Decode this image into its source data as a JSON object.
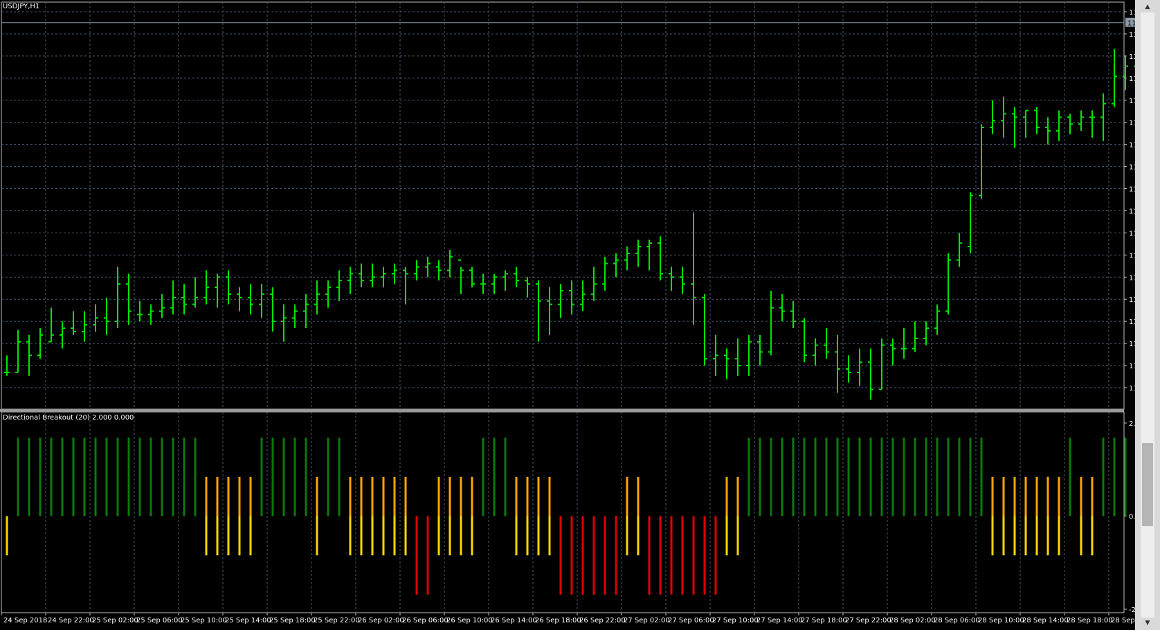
{
  "chart": {
    "symbol_label": "USDJPY,H1",
    "current_price": "113.678",
    "price_ticks": [
      "113.710",
      "113.645",
      "113.580",
      "113.515",
      "113.450",
      "113.385",
      "113.320",
      "113.255",
      "113.190",
      "113.125",
      "113.060",
      "112.995",
      "112.930",
      "112.865",
      "112.800",
      "112.735",
      "112.670",
      "112.605"
    ],
    "time_labels": [
      "24 Sep 2018",
      "24 Sep 22:00",
      "25 Sep 02:00",
      "25 Sep 06:00",
      "25 Sep 10:00",
      "25 Sep 14:00",
      "25 Sep 18:00",
      "25 Sep 22:00",
      "26 Sep 02:00",
      "26 Sep 06:00",
      "26 Sep 10:00",
      "26 Sep 14:00",
      "26 Sep 18:00",
      "26 Sep 22:00",
      "27 Sep 02:00",
      "27 Sep 06:00",
      "27 Sep 10:00",
      "27 Sep 14:00",
      "27 Sep 18:00",
      "27 Sep 22:00",
      "28 Sep 02:00",
      "28 Sep 06:00",
      "28 Sep 10:00",
      "28 Sep 14:00",
      "28 Sep 18:00",
      "28 Sep 22:00"
    ]
  },
  "indicator": {
    "label": "Directional Breakout (20) 2.000 0.000",
    "ticks": [
      "2.420",
      "0.000",
      "-2.420"
    ]
  },
  "colors": {
    "bar_up": "#00e600",
    "grid": "#4a5a6a",
    "strong_up": "#0a7a0a",
    "weak_up": "#ffa500",
    "weak_down": "#ffd700",
    "strong_down": "#e00000"
  },
  "chart_data": {
    "type": "ohlc",
    "timeframe": "H1",
    "price_bars": [
      [
        112.65,
        112.7,
        112.64,
        112.65
      ],
      [
        112.65,
        112.775,
        112.65,
        112.74
      ],
      [
        112.74,
        112.76,
        112.64,
        112.7
      ],
      [
        112.7,
        112.78,
        112.69,
        112.76
      ],
      [
        112.74,
        112.84,
        112.74,
        112.76
      ],
      [
        112.76,
        112.8,
        112.72,
        112.78
      ],
      [
        112.78,
        112.83,
        112.76,
        112.77
      ],
      [
        112.77,
        112.83,
        112.74,
        112.79
      ],
      [
        112.79,
        112.85,
        112.77,
        112.81
      ],
      [
        112.81,
        112.87,
        112.76,
        112.8
      ],
      [
        112.8,
        112.96,
        112.78,
        112.91
      ],
      [
        112.91,
        112.94,
        112.79,
        112.83
      ],
      [
        112.82,
        112.86,
        112.8,
        112.82
      ],
      [
        112.82,
        112.85,
        112.79,
        112.83
      ],
      [
        112.83,
        112.88,
        112.81,
        112.84
      ],
      [
        112.84,
        112.92,
        112.82,
        112.87
      ],
      [
        112.87,
        112.91,
        112.82,
        112.85
      ],
      [
        112.85,
        112.93,
        112.84,
        112.87
      ],
      [
        112.87,
        112.95,
        112.85,
        112.9
      ],
      [
        112.9,
        112.94,
        112.84,
        112.93
      ],
      [
        112.93,
        112.95,
        112.85,
        112.88
      ],
      [
        112.88,
        112.9,
        112.83,
        112.87
      ],
      [
        112.87,
        112.91,
        112.82,
        112.85
      ],
      [
        112.85,
        112.91,
        112.81,
        112.88
      ],
      [
        112.88,
        112.9,
        112.77,
        112.8
      ],
      [
        112.8,
        112.85,
        112.74,
        112.81
      ],
      [
        112.81,
        112.85,
        112.78,
        112.83
      ],
      [
        112.83,
        112.88,
        112.78,
        112.85
      ],
      [
        112.85,
        112.92,
        112.82,
        112.88
      ],
      [
        112.88,
        112.92,
        112.84,
        112.9
      ],
      [
        112.9,
        112.95,
        112.86,
        112.92
      ],
      [
        112.92,
        112.96,
        112.88,
        112.94
      ],
      [
        112.94,
        112.97,
        112.9,
        112.92
      ],
      [
        112.92,
        112.97,
        112.9,
        112.93
      ],
      [
        112.93,
        112.96,
        112.9,
        112.94
      ],
      [
        112.94,
        112.97,
        112.91,
        112.95
      ],
      [
        112.95,
        112.96,
        112.85,
        112.94
      ],
      [
        112.94,
        112.98,
        112.92,
        112.96
      ],
      [
        112.96,
        112.99,
        112.93,
        112.97
      ],
      [
        112.96,
        112.98,
        112.92,
        112.95
      ],
      [
        112.95,
        113.01,
        112.93,
        112.99
      ],
      [
        112.98,
        112.96,
        112.88,
        112.95
      ],
      [
        112.95,
        112.96,
        112.9,
        112.91
      ],
      [
        112.91,
        112.94,
        112.88,
        112.91
      ],
      [
        112.91,
        112.94,
        112.88,
        112.93
      ],
      [
        112.93,
        112.95,
        112.89,
        112.94
      ],
      [
        112.94,
        112.96,
        112.9,
        112.92
      ],
      [
        112.92,
        112.93,
        112.87,
        112.91
      ],
      [
        112.91,
        112.92,
        112.74,
        112.86
      ],
      [
        112.86,
        112.9,
        112.76,
        112.85
      ],
      [
        112.85,
        112.91,
        112.81,
        112.89
      ],
      [
        112.89,
        112.92,
        112.82,
        112.85
      ],
      [
        112.85,
        112.92,
        112.83,
        112.88
      ],
      [
        112.88,
        112.96,
        112.86,
        112.91
      ],
      [
        112.91,
        112.99,
        112.89,
        112.97
      ],
      [
        112.97,
        113.0,
        112.93,
        112.98
      ],
      [
        112.98,
        113.02,
        112.95,
        113.0
      ],
      [
        113.0,
        113.04,
        112.96,
        113.02
      ],
      [
        113.02,
        113.04,
        112.95,
        113.03
      ],
      [
        113.03,
        113.05,
        112.92,
        112.94
      ],
      [
        112.94,
        112.96,
        112.89,
        112.93
      ],
      [
        112.93,
        112.96,
        112.88,
        112.91
      ],
      [
        112.91,
        113.12,
        112.79,
        112.87
      ],
      [
        112.87,
        112.88,
        112.67,
        112.69
      ],
      [
        112.69,
        112.76,
        112.64,
        112.7
      ],
      [
        112.7,
        112.72,
        112.63,
        112.69
      ],
      [
        112.69,
        112.75,
        112.64,
        112.67
      ],
      [
        112.67,
        112.76,
        112.64,
        112.74
      ],
      [
        112.74,
        112.76,
        112.67,
        112.71
      ],
      [
        112.71,
        112.89,
        112.7,
        112.84
      ],
      [
        112.84,
        112.88,
        112.8,
        112.83
      ],
      [
        112.83,
        112.86,
        112.78,
        112.8
      ],
      [
        112.8,
        112.81,
        112.68,
        112.7
      ],
      [
        112.7,
        112.75,
        112.67,
        112.73
      ],
      [
        112.73,
        112.78,
        112.69,
        112.71
      ],
      [
        112.71,
        112.76,
        112.59,
        112.66
      ],
      [
        112.66,
        112.7,
        112.62,
        112.65
      ],
      [
        112.65,
        112.72,
        112.61,
        112.68
      ],
      [
        112.68,
        112.72,
        112.57,
        112.6
      ],
      [
        112.6,
        112.75,
        112.6,
        112.73
      ],
      [
        112.73,
        112.75,
        112.67,
        112.72
      ],
      [
        112.72,
        112.78,
        112.69,
        112.72
      ],
      [
        112.72,
        112.8,
        112.71,
        112.75
      ],
      [
        112.75,
        112.8,
        112.73,
        112.78
      ],
      [
        112.78,
        112.85,
        112.76,
        112.83
      ],
      [
        112.83,
        113.0,
        112.82,
        112.98
      ],
      [
        112.98,
        113.06,
        112.96,
        113.03
      ],
      [
        113.02,
        113.18,
        113.0,
        113.17
      ],
      [
        113.17,
        113.38,
        113.16,
        113.37
      ],
      [
        113.37,
        113.45,
        113.35,
        113.39
      ],
      [
        113.39,
        113.46,
        113.34,
        113.41
      ],
      [
        113.41,
        113.43,
        113.31,
        113.4
      ],
      [
        113.4,
        113.42,
        113.34,
        113.42
      ],
      [
        113.42,
        113.43,
        113.35,
        113.37
      ],
      [
        113.37,
        113.4,
        113.32,
        113.36
      ],
      [
        113.36,
        113.42,
        113.33,
        113.4
      ],
      [
        113.4,
        113.41,
        113.35,
        113.38
      ],
      [
        113.38,
        113.42,
        113.36,
        113.4
      ],
      [
        113.4,
        113.42,
        113.34,
        113.4
      ],
      [
        113.4,
        113.47,
        113.33,
        113.44
      ],
      [
        113.44,
        113.6,
        113.43,
        113.52
      ],
      [
        113.52,
        113.58,
        113.48,
        113.55
      ],
      [
        113.55,
        113.56,
        113.45,
        113.53
      ],
      [
        113.53,
        113.56,
        113.47,
        113.52
      ],
      [
        113.52,
        113.61,
        113.48,
        113.56
      ],
      [
        113.56,
        113.62,
        113.42,
        113.47
      ],
      [
        113.47,
        113.55,
        113.37,
        113.41
      ],
      [
        113.41,
        113.47,
        113.36,
        113.43
      ],
      [
        113.43,
        113.49,
        113.37,
        113.41
      ],
      [
        113.41,
        113.5,
        113.33,
        113.48
      ],
      [
        113.48,
        113.49,
        113.39,
        113.43
      ],
      [
        113.43,
        113.44,
        113.36,
        113.43
      ],
      [
        113.43,
        113.44,
        113.32,
        113.4
      ],
      [
        113.4,
        113.41,
        113.34,
        113.36
      ],
      [
        113.36,
        113.44,
        113.31,
        113.37
      ],
      [
        113.37,
        113.44,
        113.36,
        113.41
      ],
      [
        113.41,
        113.52,
        113.39,
        113.5
      ],
      [
        113.5,
        113.64,
        113.44,
        113.6
      ],
      [
        113.6,
        113.63,
        113.43,
        113.47
      ],
      [
        113.47,
        113.51,
        113.46,
        113.48
      ],
      [
        113.48,
        113.6,
        113.47,
        113.57
      ],
      [
        113.57,
        113.6,
        113.53,
        113.58
      ],
      [
        113.58,
        113.61,
        113.54,
        113.6
      ],
      [
        113.6,
        113.72,
        113.6,
        113.68
      ]
    ],
    "indicator_values": [
      "y",
      "g",
      "g",
      "g",
      "g",
      "g",
      "g",
      "g",
      "g",
      "g",
      "g",
      "g",
      "g",
      "g",
      "g",
      "g",
      "g",
      "g",
      "o",
      "o",
      "o",
      "o",
      "o",
      "g",
      "g",
      "g",
      "g",
      "g",
      "o",
      "g",
      "g",
      "o",
      "o",
      "o",
      "o",
      "o",
      "o",
      "r",
      "r",
      "o",
      "o",
      "o",
      "o",
      "g",
      "g",
      "g",
      "o",
      "o",
      "o",
      "o",
      "r",
      "r",
      "r",
      "r",
      "r",
      "r",
      "o",
      "o",
      "r",
      "r",
      "r",
      "r",
      "r",
      "r",
      "r",
      "o",
      "o",
      "g",
      "g",
      "g",
      "g",
      "g",
      "g",
      "g",
      "g",
      "g",
      "g",
      "g",
      "g",
      "g",
      "g",
      "g",
      "g",
      "g",
      "g",
      "g",
      "g",
      "g",
      "g",
      "o",
      "o",
      "o",
      "o",
      "o",
      "o",
      "o",
      "g",
      "o",
      "o",
      "g",
      "g",
      "g"
    ]
  }
}
